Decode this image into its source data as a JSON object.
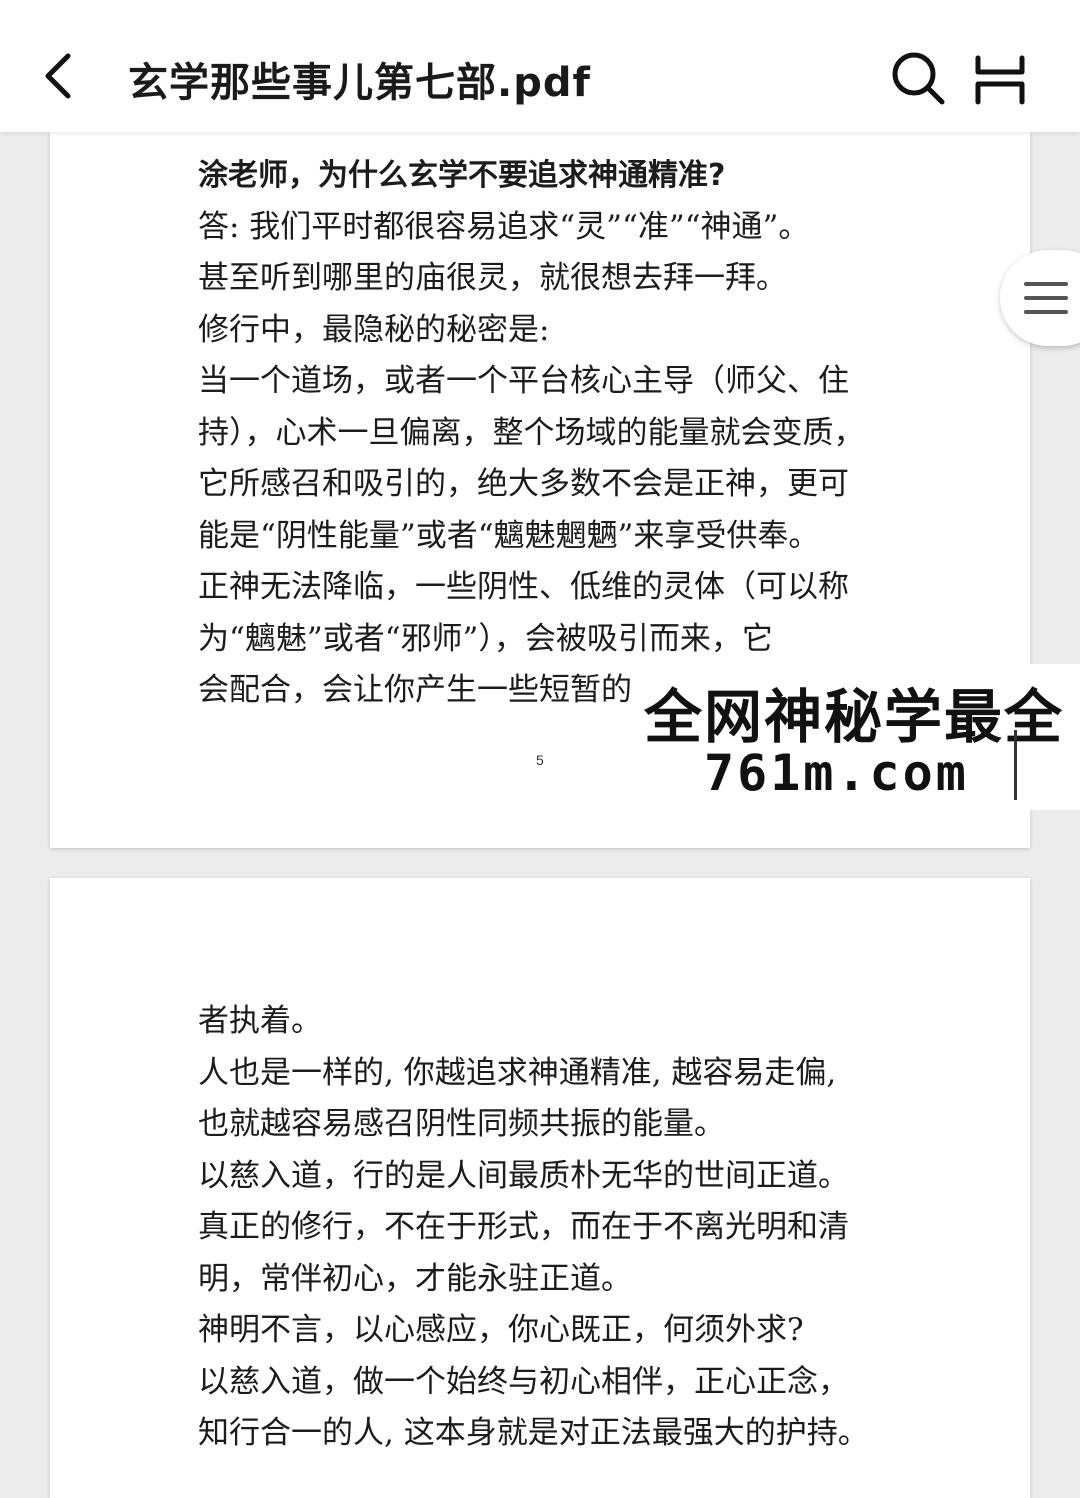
{
  "header": {
    "title": "玄学那些事儿第七部.pdf",
    "back_icon": "chevron-left-icon",
    "search_icon": "search-icon",
    "fit_width_icon": "fit-width-icon"
  },
  "side_handle": {
    "icon": "menu-icon"
  },
  "page1": {
    "lines": [
      "涂老师，为什么玄学不要追求神通精准?",
      "答: 我们平时都很容易追求“灵”“准”“神通”。",
      "甚至听到哪里的庙很灵，就很想去拜一拜。",
      "修行中，最隐秘的秘密是:",
      "当一个道场，或者一个平台核心主导（师父、住",
      "持），心术一旦偏离，整个场域的能量就会变质，",
      "它所感召和吸引的，绝大多数不会是正神，更可",
      "能是“阴性能量”或者“魑魅魍魉”来享受供奉。",
      "正神无法降临，一些阴性、低维的灵体（可以称",
      "为“魑魅”或者“邪师”），会被吸引而来，它",
      "会配合，会让你产生一些短暂的"
    ],
    "page_number": "5"
  },
  "page2": {
    "lines": [
      "者执着。",
      "人也是一样的, 你越追求神通精准, 越容易走偏,",
      "也就越容易感召阴性同频共振的能量。",
      "以慈入道，行的是人间最质朴无华的世间正道。",
      "真正的修行，不在于形式，而在于不离光明和清",
      "明，常伴初心，才能永驻正道。",
      "神明不言，以心感应，你心既正，何须外求?",
      "以慈入道，做一个始终与初心相伴，正心正念，",
      "知行合一的人, 这本身就是对正法最强大的护持。"
    ]
  },
  "watermark": {
    "line1": "全网神秘学最全",
    "line2": "761m.com"
  },
  "colors": {
    "background": "#ececec",
    "page": "#ffffff",
    "text": "#1c1c1c"
  }
}
